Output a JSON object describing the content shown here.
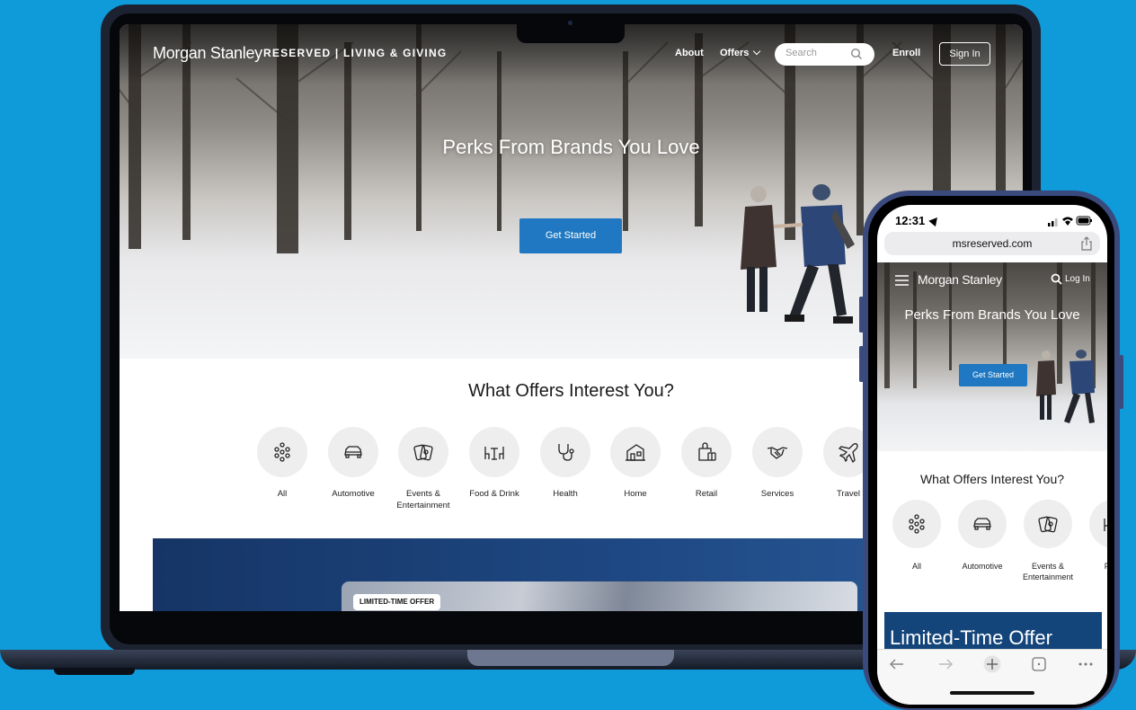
{
  "laptop": {
    "brand": "Morgan Stanley",
    "program": "RESERVED | LIVING & GIVING",
    "nav": {
      "about": "About",
      "offers": "Offers",
      "search_placeholder": "Search",
      "enroll": "Enroll",
      "sign_in": "Sign In"
    },
    "hero": {
      "title": "Perks From Brands You Love",
      "cta": "Get Started"
    },
    "offers_title": "What Offers Interest You?",
    "categories": [
      {
        "label": "All",
        "icon": "dots-grid-icon"
      },
      {
        "label": "Automotive",
        "icon": "car-icon"
      },
      {
        "label": "Events & Entertainment",
        "icon": "tickets-icon"
      },
      {
        "label": "Food & Drink",
        "icon": "table-chairs-icon"
      },
      {
        "label": "Health",
        "icon": "stethoscope-icon"
      },
      {
        "label": "Home",
        "icon": "house-icon"
      },
      {
        "label": "Retail",
        "icon": "shopping-bag-icon"
      },
      {
        "label": "Services",
        "icon": "handshake-icon"
      },
      {
        "label": "Travel",
        "icon": "airplane-icon"
      }
    ],
    "promo_badge": "LIMITED-TIME OFFER"
  },
  "phone": {
    "time": "12:31",
    "url": "msreserved.com",
    "brand": "Morgan Stanley",
    "log_in": "Log In",
    "hero_title": "Perks From Brands You Love",
    "cta": "Get Started",
    "offers_title": "What Offers Interest You?",
    "categories": [
      {
        "label": "All"
      },
      {
        "label": "Automotive"
      },
      {
        "label": "Events & Entertainment"
      },
      {
        "label": "Food"
      }
    ],
    "promo_text": "Limited-Time Offer"
  },
  "colors": {
    "background": "#0f9ad9",
    "accent_blue": "#1f78c1",
    "promo_navy": "#1b3c6e"
  }
}
